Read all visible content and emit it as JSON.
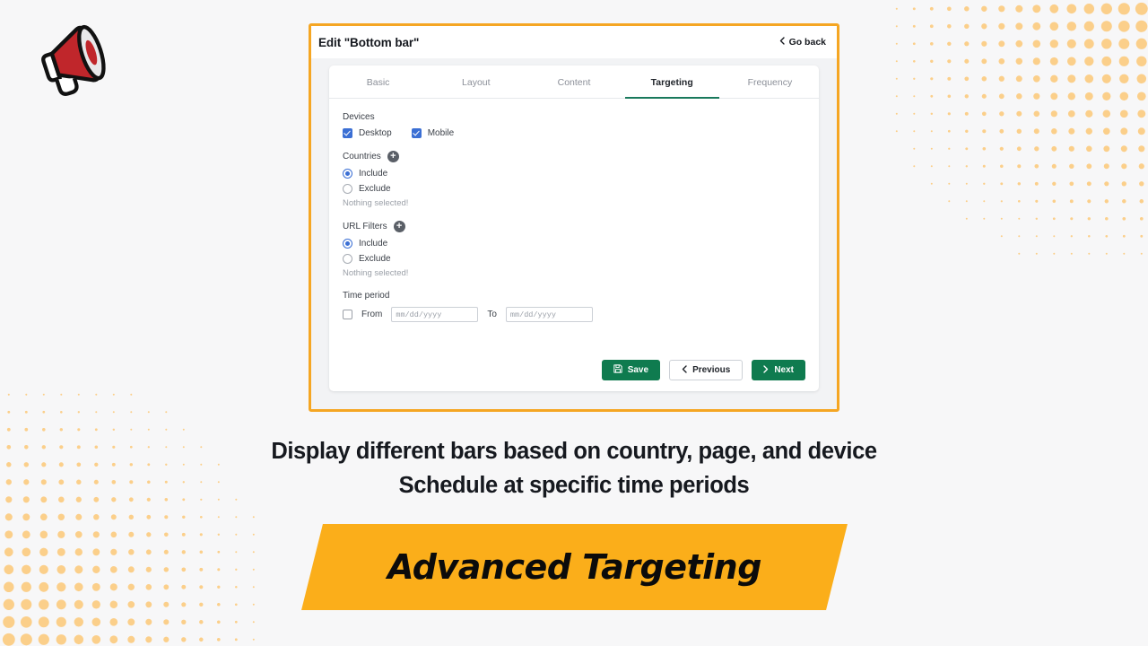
{
  "logo": {
    "icon": "megaphone-icon"
  },
  "card": {
    "title": "Edit \"Bottom bar\"",
    "go_back": "Go back",
    "tabs": [
      {
        "label": "Basic",
        "active": false
      },
      {
        "label": "Layout",
        "active": false
      },
      {
        "label": "Content",
        "active": false
      },
      {
        "label": "Targeting",
        "active": true
      },
      {
        "label": "Frequency",
        "active": false
      }
    ],
    "devices": {
      "label": "Devices",
      "options": [
        {
          "label": "Desktop",
          "checked": true
        },
        {
          "label": "Mobile",
          "checked": true
        }
      ]
    },
    "countries": {
      "label": "Countries",
      "add_icon": "plus-circle-icon",
      "options": [
        {
          "label": "Include",
          "selected": true
        },
        {
          "label": "Exclude",
          "selected": false
        }
      ],
      "hint": "Nothing selected!"
    },
    "url_filters": {
      "label": "URL Filters",
      "add_icon": "plus-circle-icon",
      "options": [
        {
          "label": "Include",
          "selected": true
        },
        {
          "label": "Exclude",
          "selected": false
        }
      ],
      "hint": "Nothing selected!"
    },
    "time_period": {
      "label": "Time period",
      "enabled": false,
      "from_label": "From",
      "from_placeholder": "mm/dd/yyyy",
      "to_label": "To",
      "to_placeholder": "mm/dd/yyyy"
    },
    "actions": {
      "save": "Save",
      "save_icon": "save-disk-icon",
      "previous": "Previous",
      "previous_icon": "chevron-left-icon",
      "next": "Next",
      "next_icon": "chevron-right-icon"
    }
  },
  "caption": {
    "line1": "Display different bars based on country, page, and device",
    "line2": "Schedule at specific time periods"
  },
  "banner": {
    "text": "Advanced Targeting"
  },
  "colors": {
    "card_border": "#F5A623",
    "tab_active_underline": "#19795c",
    "checkbox_blue": "#3b6fd4",
    "button_green": "#0f7b4f",
    "banner_orange": "#FBAE1A",
    "dot_orange": "#FBCF8A"
  }
}
